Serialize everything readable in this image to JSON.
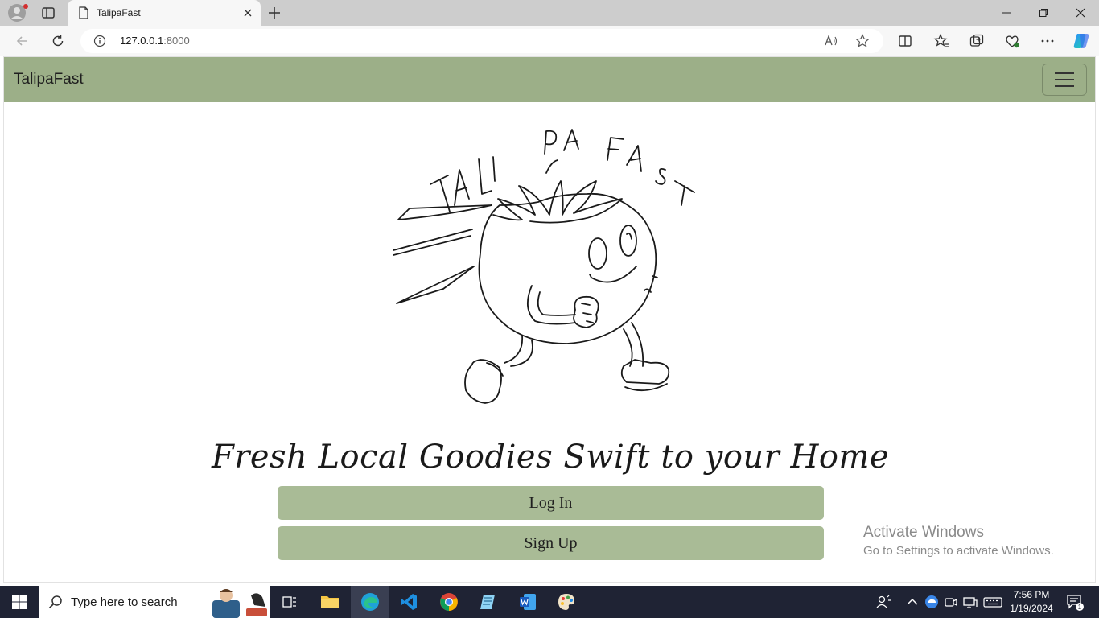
{
  "browser": {
    "tab_title": "TalipaFast",
    "address_host": "127.0.0.1",
    "address_port": ":8000"
  },
  "navbar": {
    "brand": "TalipaFast"
  },
  "hero": {
    "logo_text": "TALI PA FAST",
    "title": "Fresh Local Goodies Swift to your Home"
  },
  "buttons": {
    "login": "Log In",
    "signup": "Sign Up"
  },
  "watermark": {
    "line1": "Activate Windows",
    "line2": "Go to Settings to activate Windows."
  },
  "taskbar": {
    "search_placeholder": "Type here to search",
    "time": "7:56 PM",
    "date": "1/19/2024",
    "notification_count": "1"
  },
  "colors": {
    "navbar": "#9caf88",
    "button": "#a9bb96",
    "taskbar": "#1f2334"
  }
}
